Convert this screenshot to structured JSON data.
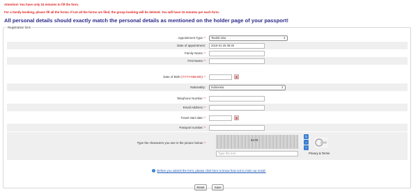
{
  "notices": {
    "time_limit": "Attention! You have only 15 minutes to fill the form.",
    "family_booking": "For a family booking, please fill all the forms. If not all the forms are filed, the group booking will be deleted. You will have 15 minutes per each form."
  },
  "headline": "All personal details should exactly match the personal details as mentioned on the holder page of your passport!",
  "form": {
    "legend": "Registration form",
    "appointment_type": {
      "label": "Appointment Type:",
      "required": "*",
      "value": "Tourist visa"
    },
    "date_of_appointment": {
      "label": "Date of appointment:",
      "value": "2016-01-25 09:30"
    },
    "family_name": {
      "label": "Family Name:",
      "required": "*",
      "value": ""
    },
    "first_name": {
      "label": "First Name:",
      "required": "*",
      "value": ""
    },
    "date_of_birth": {
      "label": "Date of Birth",
      "hint": "(YYYY-MM-DD)",
      "required": "*",
      "value": ""
    },
    "nationality": {
      "label": "Nationality:",
      "value": "Indonesia"
    },
    "telephone": {
      "label": "Telephone Number:",
      "required": "*",
      "value": ""
    },
    "email": {
      "label": "Email Address:",
      "required": "*",
      "value": ""
    },
    "travel_start": {
      "label": "Travel start date:",
      "required": "*",
      "value": ""
    },
    "passport": {
      "label": "Passport number:",
      "required": "*",
      "value": ""
    },
    "captcha": {
      "label": "Type the characters you see in the picture below:",
      "required": "*",
      "image_text": "8176",
      "placeholder": "Type the text",
      "privacy": "Privacy & Terms"
    }
  },
  "info_link": "Before you submit the form, please click here to know how not to miss our email.",
  "buttons": {
    "reset": "Reset",
    "save": "Save"
  },
  "colors": {
    "notice": "#e02020",
    "headline": "#2b2a8a",
    "row_alt": "#efefef",
    "link": "#1a55b3"
  },
  "icons": {
    "calendar": "calendar-icon",
    "info": "info-icon",
    "refresh": "refresh-icon",
    "audio": "audio-icon",
    "help": "help-icon",
    "recaptcha": "recaptcha-logo-icon"
  }
}
